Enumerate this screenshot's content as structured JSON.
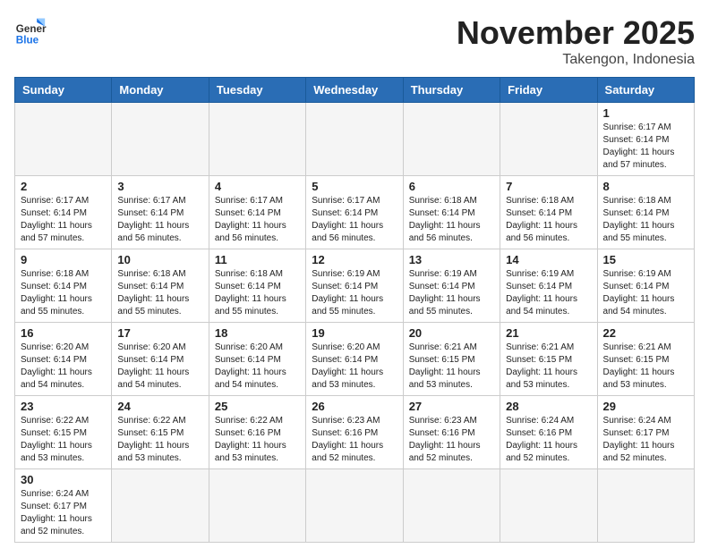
{
  "logo": {
    "general": "General",
    "blue": "Blue"
  },
  "title": "November 2025",
  "subtitle": "Takengon, Indonesia",
  "weekdays": [
    "Sunday",
    "Monday",
    "Tuesday",
    "Wednesday",
    "Thursday",
    "Friday",
    "Saturday"
  ],
  "weeks": [
    [
      {
        "day": "",
        "info": ""
      },
      {
        "day": "",
        "info": ""
      },
      {
        "day": "",
        "info": ""
      },
      {
        "day": "",
        "info": ""
      },
      {
        "day": "",
        "info": ""
      },
      {
        "day": "",
        "info": ""
      },
      {
        "day": "1",
        "info": "Sunrise: 6:17 AM\nSunset: 6:14 PM\nDaylight: 11 hours\nand 57 minutes."
      }
    ],
    [
      {
        "day": "2",
        "info": "Sunrise: 6:17 AM\nSunset: 6:14 PM\nDaylight: 11 hours\nand 57 minutes."
      },
      {
        "day": "3",
        "info": "Sunrise: 6:17 AM\nSunset: 6:14 PM\nDaylight: 11 hours\nand 56 minutes."
      },
      {
        "day": "4",
        "info": "Sunrise: 6:17 AM\nSunset: 6:14 PM\nDaylight: 11 hours\nand 56 minutes."
      },
      {
        "day": "5",
        "info": "Sunrise: 6:17 AM\nSunset: 6:14 PM\nDaylight: 11 hours\nand 56 minutes."
      },
      {
        "day": "6",
        "info": "Sunrise: 6:18 AM\nSunset: 6:14 PM\nDaylight: 11 hours\nand 56 minutes."
      },
      {
        "day": "7",
        "info": "Sunrise: 6:18 AM\nSunset: 6:14 PM\nDaylight: 11 hours\nand 56 minutes."
      },
      {
        "day": "8",
        "info": "Sunrise: 6:18 AM\nSunset: 6:14 PM\nDaylight: 11 hours\nand 55 minutes."
      }
    ],
    [
      {
        "day": "9",
        "info": "Sunrise: 6:18 AM\nSunset: 6:14 PM\nDaylight: 11 hours\nand 55 minutes."
      },
      {
        "day": "10",
        "info": "Sunrise: 6:18 AM\nSunset: 6:14 PM\nDaylight: 11 hours\nand 55 minutes."
      },
      {
        "day": "11",
        "info": "Sunrise: 6:18 AM\nSunset: 6:14 PM\nDaylight: 11 hours\nand 55 minutes."
      },
      {
        "day": "12",
        "info": "Sunrise: 6:19 AM\nSunset: 6:14 PM\nDaylight: 11 hours\nand 55 minutes."
      },
      {
        "day": "13",
        "info": "Sunrise: 6:19 AM\nSunset: 6:14 PM\nDaylight: 11 hours\nand 55 minutes."
      },
      {
        "day": "14",
        "info": "Sunrise: 6:19 AM\nSunset: 6:14 PM\nDaylight: 11 hours\nand 54 minutes."
      },
      {
        "day": "15",
        "info": "Sunrise: 6:19 AM\nSunset: 6:14 PM\nDaylight: 11 hours\nand 54 minutes."
      }
    ],
    [
      {
        "day": "16",
        "info": "Sunrise: 6:20 AM\nSunset: 6:14 PM\nDaylight: 11 hours\nand 54 minutes."
      },
      {
        "day": "17",
        "info": "Sunrise: 6:20 AM\nSunset: 6:14 PM\nDaylight: 11 hours\nand 54 minutes."
      },
      {
        "day": "18",
        "info": "Sunrise: 6:20 AM\nSunset: 6:14 PM\nDaylight: 11 hours\nand 54 minutes."
      },
      {
        "day": "19",
        "info": "Sunrise: 6:20 AM\nSunset: 6:14 PM\nDaylight: 11 hours\nand 53 minutes."
      },
      {
        "day": "20",
        "info": "Sunrise: 6:21 AM\nSunset: 6:15 PM\nDaylight: 11 hours\nand 53 minutes."
      },
      {
        "day": "21",
        "info": "Sunrise: 6:21 AM\nSunset: 6:15 PM\nDaylight: 11 hours\nand 53 minutes."
      },
      {
        "day": "22",
        "info": "Sunrise: 6:21 AM\nSunset: 6:15 PM\nDaylight: 11 hours\nand 53 minutes."
      }
    ],
    [
      {
        "day": "23",
        "info": "Sunrise: 6:22 AM\nSunset: 6:15 PM\nDaylight: 11 hours\nand 53 minutes."
      },
      {
        "day": "24",
        "info": "Sunrise: 6:22 AM\nSunset: 6:15 PM\nDaylight: 11 hours\nand 53 minutes."
      },
      {
        "day": "25",
        "info": "Sunrise: 6:22 AM\nSunset: 6:16 PM\nDaylight: 11 hours\nand 53 minutes."
      },
      {
        "day": "26",
        "info": "Sunrise: 6:23 AM\nSunset: 6:16 PM\nDaylight: 11 hours\nand 52 minutes."
      },
      {
        "day": "27",
        "info": "Sunrise: 6:23 AM\nSunset: 6:16 PM\nDaylight: 11 hours\nand 52 minutes."
      },
      {
        "day": "28",
        "info": "Sunrise: 6:24 AM\nSunset: 6:16 PM\nDaylight: 11 hours\nand 52 minutes."
      },
      {
        "day": "29",
        "info": "Sunrise: 6:24 AM\nSunset: 6:17 PM\nDaylight: 11 hours\nand 52 minutes."
      }
    ],
    [
      {
        "day": "30",
        "info": "Sunrise: 6:24 AM\nSunset: 6:17 PM\nDaylight: 11 hours\nand 52 minutes."
      },
      {
        "day": "",
        "info": ""
      },
      {
        "day": "",
        "info": ""
      },
      {
        "day": "",
        "info": ""
      },
      {
        "day": "",
        "info": ""
      },
      {
        "day": "",
        "info": ""
      },
      {
        "day": "",
        "info": ""
      }
    ]
  ]
}
